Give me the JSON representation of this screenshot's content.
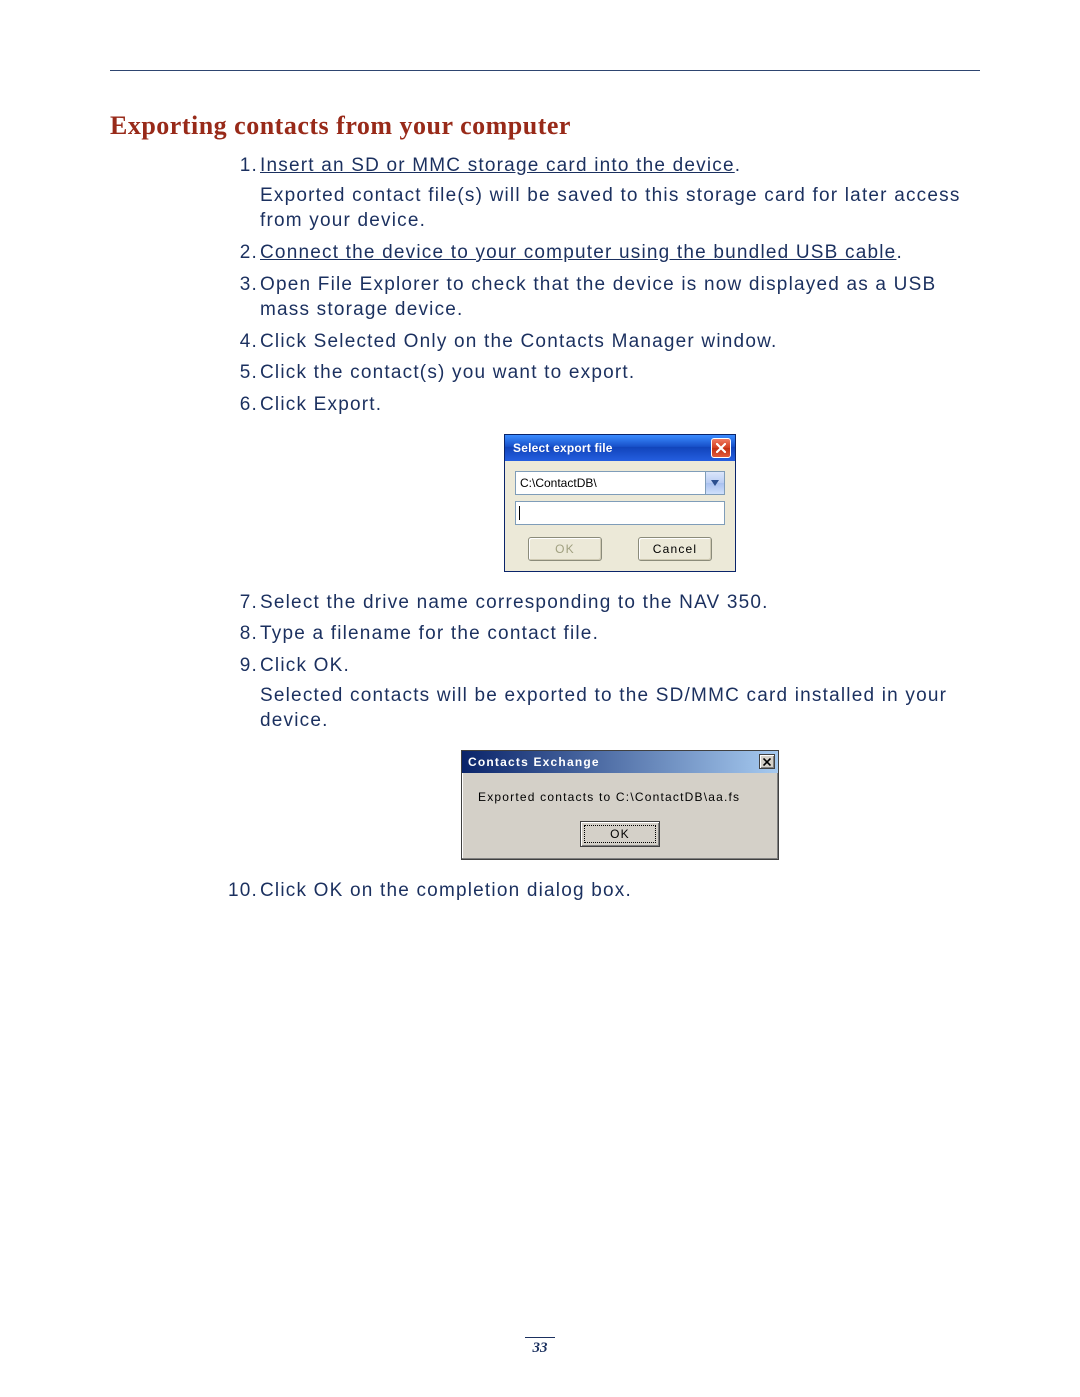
{
  "heading": "Exporting contacts from your computer",
  "steps": {
    "s1_link": "Insert an SD or MMC storage card into the device",
    "s1_note": "Exported contact file(s) will be saved to this storage card for later access from your device.",
    "s2_link": "Connect the device to your computer using the bundled USB cable",
    "s3": "Open File Explorer to check that the device is now displayed as a USB mass storage device.",
    "s4": "Click Selected Only on the Contacts Manager window.",
    "s5": "Click the contact(s) you want to export.",
    "s6": "Click Export.",
    "s7": "Select the drive name corresponding to the NAV 350.",
    "s8": "Type a filename for the contact file.",
    "s9": "Click OK.",
    "s9_note": "Selected contacts will be exported to the SD/MMC card installed in your device.",
    "s10": "Click OK on the completion dialog box."
  },
  "dialog1": {
    "title": "Select export file",
    "path": "C:\\ContactDB\\",
    "filename": "",
    "ok": "OK",
    "cancel": "Cancel"
  },
  "dialog2": {
    "title": "Contacts Exchange",
    "message": "Exported contacts to C:\\ContactDB\\aa.fs",
    "ok": "OK"
  },
  "page_number": "33"
}
